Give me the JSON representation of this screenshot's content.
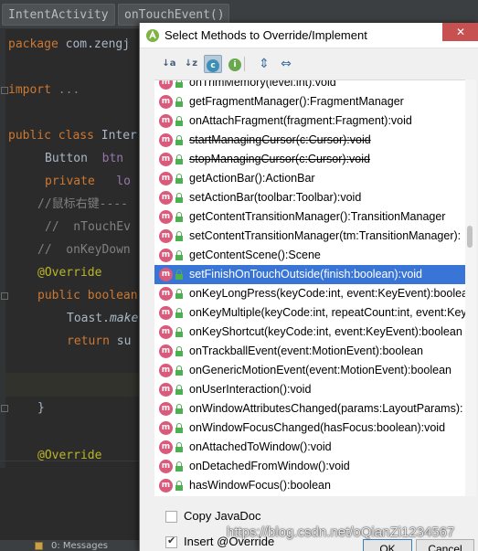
{
  "editor": {
    "tabs": [
      "IntentActivity",
      "onTouchEvent()"
    ],
    "lines": {
      "package_kw": "package",
      "package_rest": " com.zengj",
      "import_kw": "import",
      "import_rest": " ...",
      "class_kw": "public class",
      "class_rest": " Inter",
      "button_type": "Button",
      "button_name": "  btn",
      "private_kw": "private",
      "private_rest": "   lo",
      "comment1": "//鼠标右键----",
      "comment2": "//  nTouchEv",
      "comment3": "//  onKeyDown",
      "override1": "@Override",
      "public_kw": "public boolean",
      "toast": "Toast.",
      "toast_call": "make",
      "return_kw": "return",
      "return_rest": " su",
      "brace": "}",
      "override2": "@Override"
    },
    "status": {
      "messages": "0: Messages"
    }
  },
  "dialog": {
    "title": "Select Methods to Override/Implement",
    "close": "✕",
    "toolbar": {
      "sort_alpha": "↓a",
      "sort_hier": "↓z",
      "class_toggle": "c",
      "interface_toggle": "i",
      "expand_all": "⇕",
      "collapse_all": "⇔"
    },
    "methods": [
      {
        "name": "onTrimMemory(level:int):void",
        "deprecated": false,
        "selected": false
      },
      {
        "name": "getFragmentManager():FragmentManager",
        "deprecated": false,
        "selected": false
      },
      {
        "name": "onAttachFragment(fragment:Fragment):void",
        "deprecated": false,
        "selected": false
      },
      {
        "name": "startManagingCursor(c:Cursor):void",
        "deprecated": true,
        "selected": false
      },
      {
        "name": "stopManagingCursor(c:Cursor):void",
        "deprecated": true,
        "selected": false
      },
      {
        "name": "getActionBar():ActionBar",
        "deprecated": false,
        "selected": false
      },
      {
        "name": "setActionBar(toolbar:Toolbar):void",
        "deprecated": false,
        "selected": false
      },
      {
        "name": "getContentTransitionManager():TransitionManager",
        "deprecated": false,
        "selected": false
      },
      {
        "name": "setContentTransitionManager(tm:TransitionManager):",
        "deprecated": false,
        "selected": false
      },
      {
        "name": "getContentScene():Scene",
        "deprecated": false,
        "selected": false
      },
      {
        "name": "setFinishOnTouchOutside(finish:boolean):void",
        "deprecated": false,
        "selected": true
      },
      {
        "name": "onKeyLongPress(keyCode:int, event:KeyEvent):boolea",
        "deprecated": false,
        "selected": false
      },
      {
        "name": "onKeyMultiple(keyCode:int, repeatCount:int, event:Key",
        "deprecated": false,
        "selected": false
      },
      {
        "name": "onKeyShortcut(keyCode:int, event:KeyEvent):boolean",
        "deprecated": false,
        "selected": false
      },
      {
        "name": "onTrackballEvent(event:MotionEvent):boolean",
        "deprecated": false,
        "selected": false
      },
      {
        "name": "onGenericMotionEvent(event:MotionEvent):boolean",
        "deprecated": false,
        "selected": false
      },
      {
        "name": "onUserInteraction():void",
        "deprecated": false,
        "selected": false
      },
      {
        "name": "onWindowAttributesChanged(params:LayoutParams):",
        "deprecated": false,
        "selected": false
      },
      {
        "name": "onWindowFocusChanged(hasFocus:boolean):void",
        "deprecated": false,
        "selected": false
      },
      {
        "name": "onAttachedToWindow():void",
        "deprecated": false,
        "selected": false
      },
      {
        "name": "onDetachedFromWindow():void",
        "deprecated": false,
        "selected": false
      },
      {
        "name": "hasWindowFocus():boolean",
        "deprecated": false,
        "selected": false
      }
    ],
    "copy_javadoc": {
      "label": "Copy JavaDoc",
      "checked": false
    },
    "insert_override": {
      "label": "Insert @Override",
      "checked": true
    },
    "ok_label": "OK",
    "cancel_label": "Cancel"
  },
  "watermark": "https://blog.csdn.net/oQianZi1234567",
  "colors": {
    "selection": "#3875d7",
    "method_icon": "#d95a7a",
    "lock_icon": "#4caf50",
    "close_button": "#c75050"
  }
}
